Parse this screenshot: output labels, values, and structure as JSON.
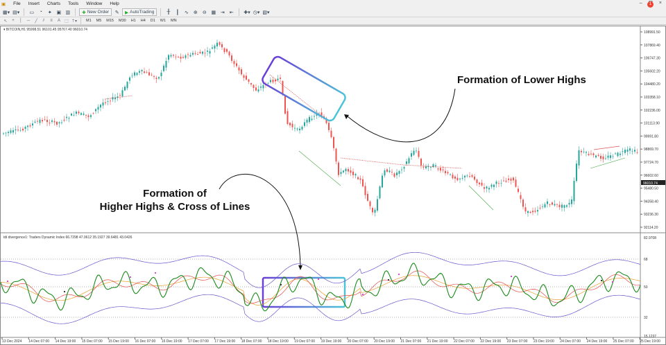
{
  "menu": {
    "items": [
      "File",
      "Insert",
      "Charts",
      "Tools",
      "Window",
      "Help"
    ],
    "notify_count": "1"
  },
  "toolbar": {
    "new_order": "New Order",
    "autotrading": "AutoTrading"
  },
  "timeframes": [
    "M1",
    "M5",
    "M15",
    "M30",
    "H1",
    "H4",
    "D1",
    "W1",
    "MN"
  ],
  "main_chart": {
    "info": "BITCOIN,H1  95998.51 96101.45 95767.40 96010.74",
    "price_labels": [
      "108991.50",
      "107869.40",
      "106747.30",
      "105602.20",
      "104480.20",
      "103358.10",
      "102236.00",
      "101113.90",
      "99991.80",
      "98869.70",
      "97724.70",
      "96602.60",
      "95480.50",
      "94358.40",
      "93236.30",
      "92114.20"
    ],
    "current_price": "96010.74",
    "colors": {
      "bull": "#26a69a",
      "bear": "#ef5350"
    }
  },
  "indicator": {
    "info": "tdi divergence1: Traders Dynamic Index 66.7298 47.0612 35.1927 39.6481 43.0426",
    "scale_labels": [
      "82.9708",
      "68",
      "50",
      "32",
      "15.1237"
    ]
  },
  "time_labels": [
    "13 Dec 2024",
    "14 Dec 07:00",
    "14 Dec 19:00",
    "15 Dec 07:00",
    "15 Dec 19:00",
    "16 Dec 07:00",
    "16 Dec 19:00",
    "17 Dec 07:00",
    "17 Dec 19:00",
    "18 Dec 07:00",
    "18 Dec 19:00",
    "19 Dec 07:00",
    "19 Dec 19:00",
    "20 Dec 07:00",
    "20 Dec 19:00",
    "21 Dec 07:00",
    "21 Dec 19:00",
    "22 Dec 07:00",
    "22 Dec 19:00",
    "23 Dec 07:00",
    "23 Dec 19:00",
    "24 Dec 07:00",
    "24 Dec 19:00",
    "25 Dec 07:00",
    "25 Dec 19:00"
  ],
  "annotations": {
    "lower_highs": "Formation of Lower Highs",
    "higher_highs_line1": "Formation of",
    "higher_highs_line2": "Higher Highs & Cross of Lines"
  }
}
